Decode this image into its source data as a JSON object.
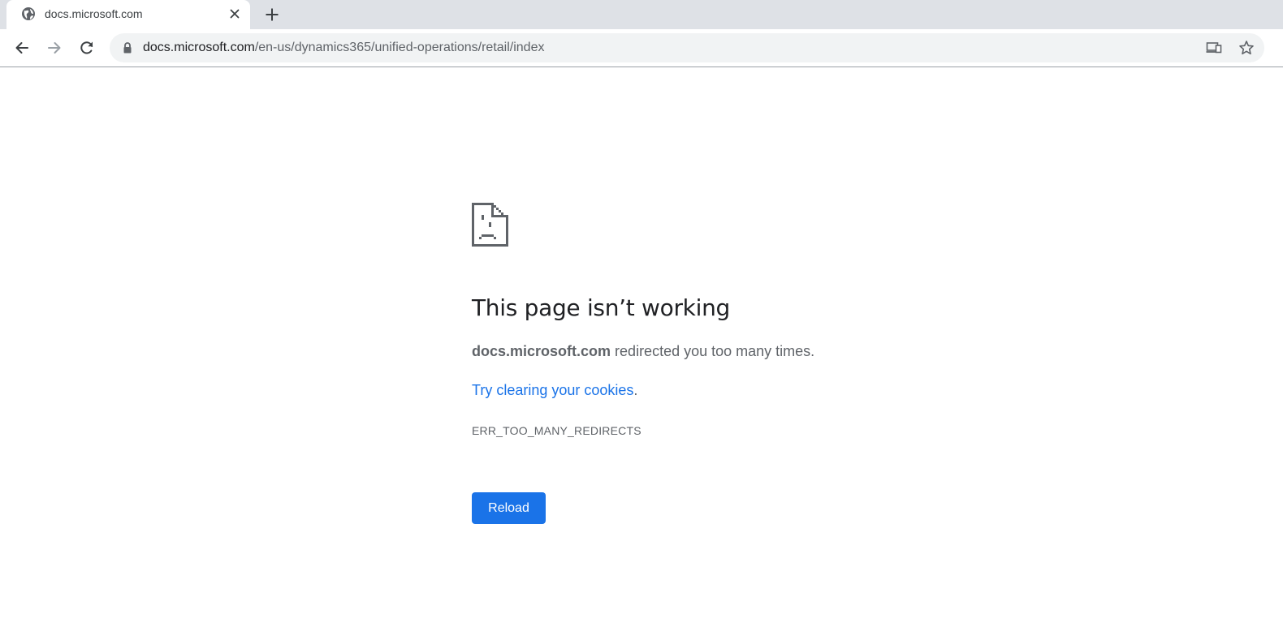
{
  "browser": {
    "tab": {
      "title": "docs.microsoft.com",
      "favicon": "globe-icon"
    },
    "newtab_icon": "plus-icon",
    "nav": {
      "back_icon": "back-arrow-icon",
      "forward_icon": "forward-arrow-icon",
      "reload_icon": "reload-icon"
    },
    "omnibox": {
      "lock_icon": "lock-icon",
      "url_host": "docs.microsoft.com",
      "url_path": "/en-us/dynamics365/unified-operations/retail/index",
      "cast_icon": "devices-icon",
      "bookmark_icon": "star-icon"
    }
  },
  "error_page": {
    "icon": "sad-page-icon",
    "heading": "This page isn’t working",
    "message_host": "docs.microsoft.com",
    "message_rest": " redirected you too many times.",
    "suggestion_link": "Try clearing your cookies",
    "suggestion_period": ".",
    "error_code": "ERR_TOO_MANY_REDIRECTS",
    "reload_label": "Reload"
  },
  "colors": {
    "tabstrip_bg": "#dee1e6",
    "omnibox_bg": "#f1f3f4",
    "link": "#1a73e8",
    "button_bg": "#1a73e8",
    "heading_text": "#202124",
    "body_text": "#5f6368"
  }
}
